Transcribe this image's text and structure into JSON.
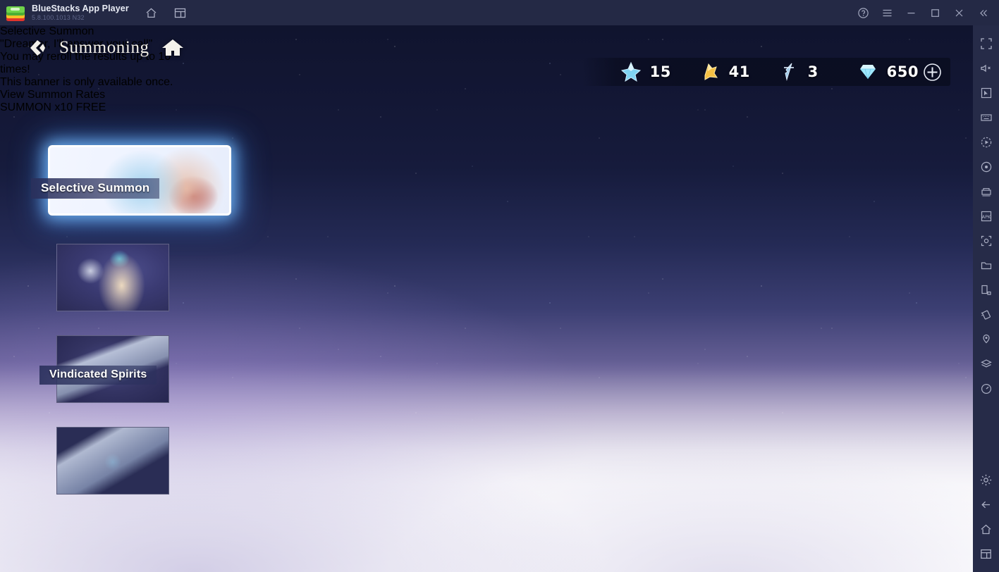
{
  "window": {
    "app_name": "BlueStacks App Player",
    "version": "5.8.100.1013  N32",
    "titlebar_icons": [
      "home-icon",
      "multi-instance-icon"
    ],
    "controls": [
      "help-icon",
      "menu-icon",
      "minimize-icon",
      "maximize-icon",
      "close-icon",
      "collapse-icon"
    ]
  },
  "rail": {
    "icons": [
      "fullscreen-icon",
      "mute-icon",
      "pointer-icon",
      "keyboard-icon",
      "macro-record-icon",
      "eco-mode-icon",
      "multi-instance-manager-icon",
      "install-apk-icon",
      "screenshot-icon",
      "media-folder-icon",
      "rotate-screen-icon",
      "shake-icon",
      "location-icon",
      "layers-icon",
      "performance-icon",
      "settings-icon",
      "back-icon",
      "home-icon",
      "recents-icon"
    ]
  },
  "game": {
    "header": {
      "back_label": "back-arrow-icon",
      "title": "Summoning",
      "home_label": "home-icon"
    },
    "currencies": [
      {
        "icon": "blue-crystal-icon",
        "value": "15",
        "color": "#7fd4f2"
      },
      {
        "icon": "gold-shard-icon",
        "value": "41",
        "color": "#f5c043"
      },
      {
        "icon": "silver-spear-icon",
        "value": "3",
        "color": "#9fc9e8"
      },
      {
        "icon": "diamond-icon",
        "value": "650",
        "color": "#9fe8ff"
      }
    ],
    "add_currency_label": "plus-icon",
    "banner_list": [
      {
        "label": "Selective Summon",
        "selected": true
      },
      {
        "label": "",
        "selected": false
      },
      {
        "label": "Vindicated Spirits",
        "selected": false
      },
      {
        "label": "",
        "selected": false
      }
    ],
    "banner": {
      "title": "Selective Summon",
      "subtitle": "\"Dreamer, I'll answer your call\"",
      "description_line1": "You may reroll the results up to 10",
      "description_line2": "times!",
      "description_line3": "This banner is only available once.",
      "rates_link": "View Summon Rates"
    },
    "summon_button": {
      "label": "SUMMON x10",
      "cost": "FREE",
      "cost_color": "#4aa8f5"
    }
  }
}
